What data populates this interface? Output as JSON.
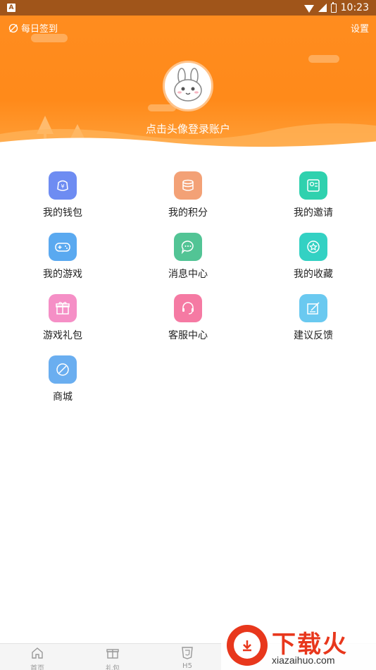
{
  "status_bar": {
    "app_icon_letter": "A",
    "time": "10:23"
  },
  "header": {
    "checkin_label": "每日签到",
    "settings_label": "设置",
    "login_prompt": "点击头像登录账户"
  },
  "menu": [
    {
      "label": "我的钱包",
      "icon": "wallet-icon",
      "color": "#6e8cf2"
    },
    {
      "label": "我的积分",
      "icon": "points-icon",
      "color": "#f3a176"
    },
    {
      "label": "我的邀请",
      "icon": "invite-icon",
      "color": "#2fd1ae"
    },
    {
      "label": "我的游戏",
      "icon": "gamepad-icon",
      "color": "#5aa9f0"
    },
    {
      "label": "消息中心",
      "icon": "message-icon",
      "color": "#52c495"
    },
    {
      "label": "我的收藏",
      "icon": "star-icon",
      "color": "#33d1c3"
    },
    {
      "label": "游戏礼包",
      "icon": "gift-icon",
      "color": "#f58fc6"
    },
    {
      "label": "客服中心",
      "icon": "headset-icon",
      "color": "#f57aa3"
    },
    {
      "label": "建议反馈",
      "icon": "feedback-icon",
      "color": "#6ac9f0"
    },
    {
      "label": "商城",
      "icon": "shop-icon",
      "color": "#6aaef0"
    }
  ],
  "bottom_nav": {
    "home_label": "首页",
    "gift_label": "礼包",
    "h5_label": "H5"
  },
  "watermark": {
    "title": "下载火",
    "url": "xiazaihuo.com"
  }
}
